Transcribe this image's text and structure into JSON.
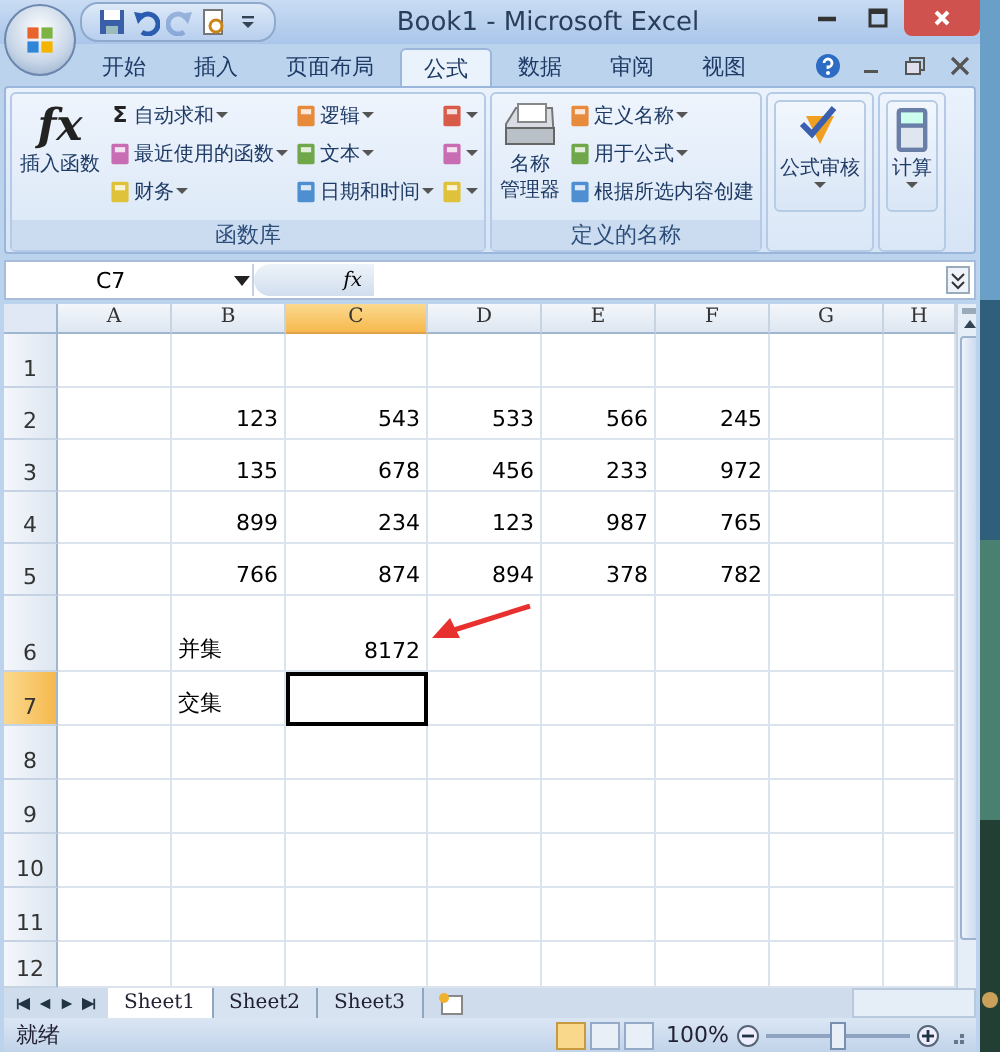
{
  "window": {
    "title": "Book1 - Microsoft Excel"
  },
  "quick_access": [
    {
      "kind": "save",
      "disabled": false
    },
    {
      "kind": "undo",
      "disabled": false
    },
    {
      "kind": "redo",
      "disabled": true
    },
    {
      "kind": "preview",
      "disabled": false
    }
  ],
  "ribbon_tabs": [
    {
      "label": "开始",
      "selected": false
    },
    {
      "label": "插入",
      "selected": false
    },
    {
      "label": "页面布局",
      "selected": false
    },
    {
      "label": "公式",
      "selected": true
    },
    {
      "label": "数据",
      "selected": false
    },
    {
      "label": "审阅",
      "selected": false
    },
    {
      "label": "视图",
      "selected": false
    }
  ],
  "ribbon_groups": [
    {
      "label": "函数库",
      "large": {
        "kind": "fx",
        "icon_text": "fx",
        "lines": [
          "插入函数"
        ],
        "dropdown": false
      },
      "columns": [
        [
          {
            "label": "自动求和",
            "icon_text": "Σ",
            "dropdown": true
          },
          {
            "label": "最近使用的函数",
            "dropdown": true
          },
          {
            "label": "财务",
            "dropdown": true
          }
        ],
        [
          {
            "label": "逻辑",
            "dropdown": true
          },
          {
            "label": "文本",
            "dropdown": true
          },
          {
            "label": "日期和时间",
            "dropdown": true
          }
        ],
        [
          {
            "dropdown": true
          },
          {
            "dropdown": true
          },
          {
            "dropdown": true
          }
        ]
      ]
    },
    {
      "label": "定义的名称",
      "large": {
        "kind": "names",
        "lines": [
          "名称",
          "管理器"
        ],
        "dropdown": false
      },
      "columns": [
        [
          {
            "label": "定义名称",
            "dropdown": true
          },
          {
            "label": "用于公式",
            "dropdown": true
          },
          {
            "label": "根据所选内容创建",
            "dropdown": false
          }
        ]
      ]
    },
    {
      "large": {
        "kind": "audit",
        "lines": [
          "公式审核"
        ],
        "dropdown": true
      }
    },
    {
      "large": {
        "kind": "calc",
        "lines": [
          "计算"
        ],
        "dropdown": true
      }
    }
  ],
  "name_box": {
    "value": "C7"
  },
  "formula_bar": {
    "function_button": "fx"
  },
  "columns": [
    {
      "label": "A",
      "selected": false
    },
    {
      "label": "B",
      "selected": false
    },
    {
      "label": "C",
      "selected": true
    },
    {
      "label": "D",
      "selected": false
    },
    {
      "label": "E",
      "selected": false
    },
    {
      "label": "F",
      "selected": false
    },
    {
      "label": "G",
      "selected": false
    },
    {
      "label": "H",
      "selected": false
    }
  ],
  "rows": [
    {
      "header": "1",
      "selected": false
    },
    {
      "header": "2",
      "selected": false,
      "cells": [
        null,
        {
          "kind": "number",
          "text": "123"
        },
        {
          "kind": "number",
          "text": "543"
        },
        {
          "kind": "number",
          "text": "533"
        },
        {
          "kind": "number",
          "text": "566"
        },
        {
          "kind": "number",
          "text": "245"
        }
      ]
    },
    {
      "header": "3",
      "selected": false,
      "cells": [
        null,
        {
          "kind": "number",
          "text": "135"
        },
        {
          "kind": "number",
          "text": "678"
        },
        {
          "kind": "number",
          "text": "456"
        },
        {
          "kind": "number",
          "text": "233"
        },
        {
          "kind": "number",
          "text": "972"
        }
      ]
    },
    {
      "header": "4",
      "selected": false,
      "cells": [
        null,
        {
          "kind": "number",
          "text": "899"
        },
        {
          "kind": "number",
          "text": "234"
        },
        {
          "kind": "number",
          "text": "123"
        },
        {
          "kind": "number",
          "text": "987"
        },
        {
          "kind": "number",
          "text": "765"
        }
      ]
    },
    {
      "header": "5",
      "selected": false,
      "cells": [
        null,
        {
          "kind": "number",
          "text": "766"
        },
        {
          "kind": "number",
          "text": "874"
        },
        {
          "kind": "number",
          "text": "894"
        },
        {
          "kind": "number",
          "text": "378"
        },
        {
          "kind": "number",
          "text": "782"
        }
      ]
    },
    {
      "header": "6",
      "selected": false,
      "cells": [
        null,
        {
          "kind": "text",
          "text": "并集"
        },
        {
          "kind": "number",
          "text": "8172",
          "marked": true
        }
      ]
    },
    {
      "header": "7",
      "selected": true,
      "cells": [
        null,
        {
          "kind": "text",
          "text": "交集"
        },
        {
          "kind": "empty",
          "selected": true
        }
      ]
    },
    {
      "header": "8",
      "selected": false
    },
    {
      "header": "9",
      "selected": false
    },
    {
      "header": "10",
      "selected": false
    },
    {
      "header": "11",
      "selected": false
    },
    {
      "header": "12",
      "selected": false
    }
  ],
  "sheet_tabs": [
    {
      "label": "Sheet1",
      "selected": true
    },
    {
      "label": "Sheet2",
      "selected": false
    },
    {
      "label": "Sheet3",
      "selected": false
    }
  ],
  "status_bar": {
    "text": "就绪",
    "view_buttons": [
      {
        "selected": true
      },
      {
        "selected": false
      },
      {
        "selected": false
      }
    ],
    "zoom": "100%",
    "level": 0.5
  }
}
